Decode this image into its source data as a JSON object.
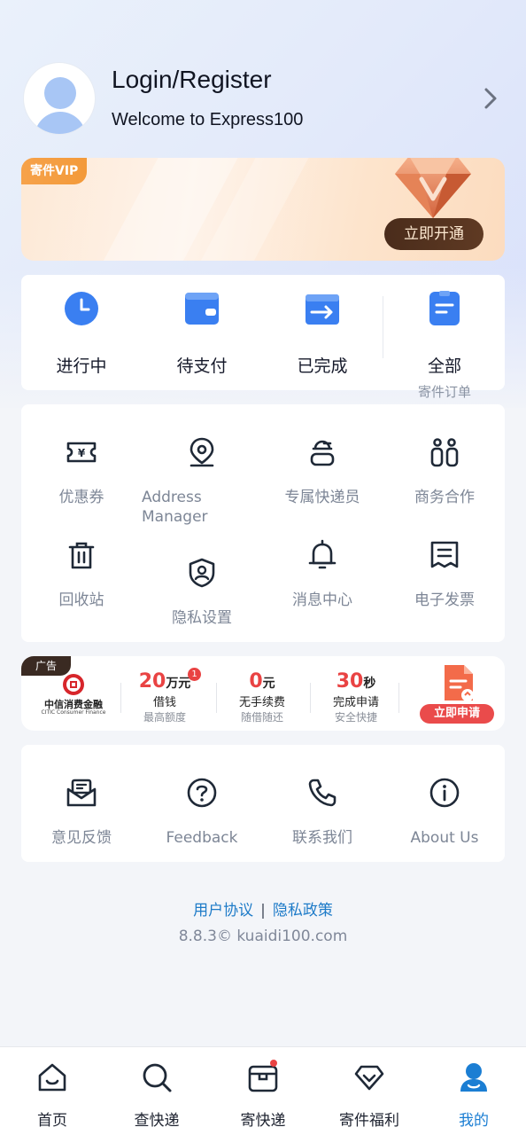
{
  "colors": {
    "accent": "#1b7ed3",
    "icon_blue": "#3a7ff1",
    "ad_red": "#e94343",
    "vip_brown": "#4a2c1b"
  },
  "profile": {
    "title": "Login/Register",
    "subtitle": "Welcome to Express100",
    "avatar_icon": "user-avatar-icon",
    "arrow_icon": "chevron-right-icon"
  },
  "vip": {
    "tag": "寄件VIP",
    "button": "立即开通",
    "icon": "diamond-icon"
  },
  "orders": {
    "items": [
      {
        "label": "进行中",
        "icon": "clock-icon"
      },
      {
        "label": "待支付",
        "icon": "wallet-icon"
      },
      {
        "label": "已完成",
        "icon": "box-arrow-icon"
      },
      {
        "label": "全部",
        "sub": "寄件订单",
        "icon": "order-list-icon"
      }
    ]
  },
  "tools": {
    "items": [
      {
        "label": "优惠券",
        "icon": "coupon-icon"
      },
      {
        "label": "Address Manager",
        "icon": "location-pin-icon"
      },
      {
        "label": "专属快递员",
        "icon": "courier-icon"
      },
      {
        "label": "商务合作",
        "icon": "partners-icon"
      },
      {
        "label": "回收站",
        "icon": "trash-icon"
      },
      {
        "label": "隐私设置",
        "icon": "privacy-shield-icon"
      },
      {
        "label": "消息中心",
        "icon": "bell-icon"
      },
      {
        "label": "电子发票",
        "icon": "invoice-icon"
      }
    ]
  },
  "ad": {
    "tag": "广告",
    "brand_name": "中信消费金融",
    "brand_en": "CITIC Consumer Finance",
    "badge": "1",
    "stats": [
      {
        "num": "20",
        "unit": "万元",
        "line1": "借钱",
        "line2": "最高额度"
      },
      {
        "num": "0",
        "unit": "元",
        "line1": "无手续费",
        "line2": "随借随还"
      },
      {
        "num": "30",
        "unit": "秒",
        "line1": "完成申请",
        "line2": "安全快捷"
      }
    ],
    "button": "立即申请"
  },
  "more": {
    "items": [
      {
        "label": "意见反馈",
        "icon": "feedback-icon"
      },
      {
        "label": "Feedback",
        "icon": "question-icon"
      },
      {
        "label": "联系我们",
        "icon": "phone-icon"
      },
      {
        "label": "About Us",
        "icon": "info-icon"
      }
    ]
  },
  "footer": {
    "agreement": "用户协议",
    "separator": "|",
    "privacy": "隐私政策",
    "version": "8.8.3© kuaidi100.com"
  },
  "nav": {
    "items": [
      {
        "label": "首页",
        "icon": "home-icon"
      },
      {
        "label": "查快递",
        "icon": "search-icon"
      },
      {
        "label": "寄快递",
        "icon": "parcel-icon"
      },
      {
        "label": "寄件福利",
        "icon": "gift-diamond-icon"
      },
      {
        "label": "我的",
        "icon": "profile-icon"
      }
    ],
    "active_index": 4
  }
}
